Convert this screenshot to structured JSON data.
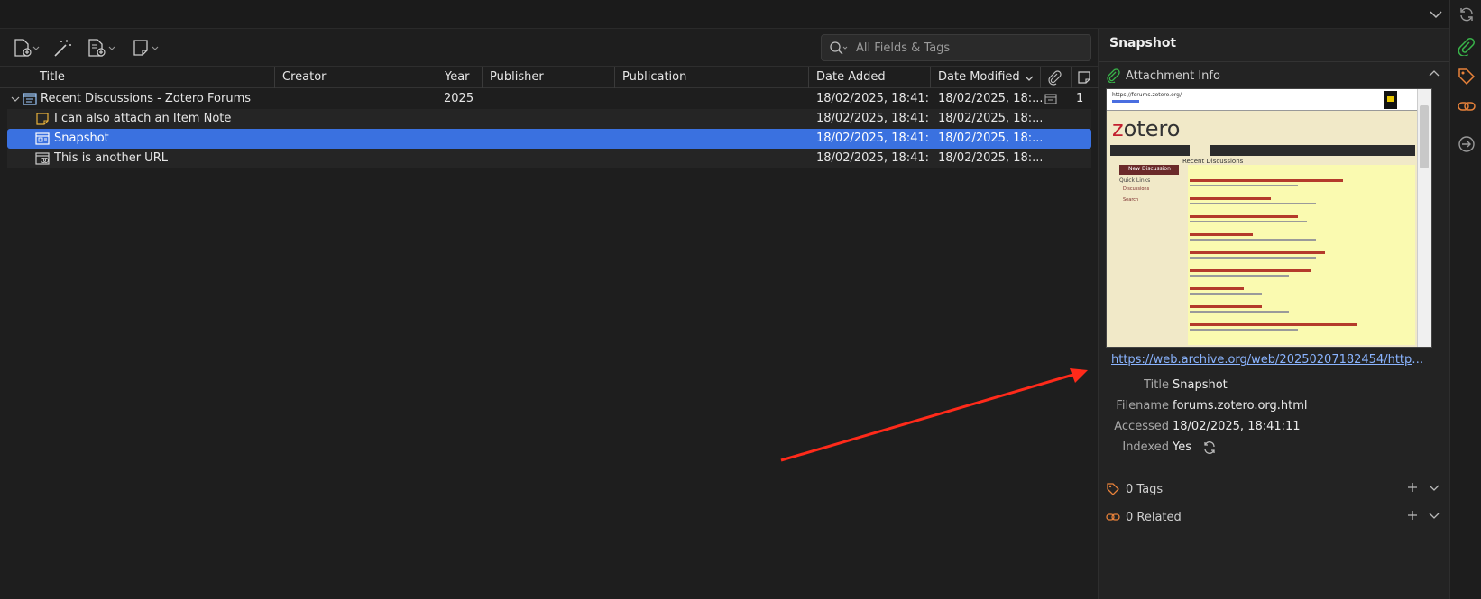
{
  "search": {
    "placeholder": "All Fields & Tags"
  },
  "columns": {
    "title": "Title",
    "creator": "Creator",
    "year": "Year",
    "publisher": "Publisher",
    "publication": "Publication",
    "date_added": "Date Added",
    "date_modified": "Date Modified"
  },
  "items": [
    {
      "title": "Recent Discussions - Zotero Forums",
      "year": "2025",
      "date_added": "18/02/2025, 18:41:...",
      "date_modified": "18/02/2025, 18:...",
      "notes": "1",
      "icon": "webpage-icon"
    },
    {
      "title": "I can also attach an Item Note",
      "year": "",
      "date_added": "18/02/2025, 18:41:...",
      "date_modified": "18/02/2025, 18:...",
      "notes": "",
      "icon": "note-icon"
    },
    {
      "title": "Snapshot",
      "year": "",
      "date_added": "18/02/2025, 18:41:...",
      "date_modified": "18/02/2025, 18:...",
      "notes": "",
      "icon": "snapshot-icon"
    },
    {
      "title": "This is another URL",
      "year": "",
      "date_added": "18/02/2025, 18:41:...",
      "date_modified": "18/02/2025, 18:...",
      "notes": "",
      "icon": "link-icon"
    }
  ],
  "pane": {
    "title": "Snapshot",
    "attachment_info": "Attachment Info",
    "url": "https://web.archive.org/web/20250207182454/https://foru...",
    "fields": [
      {
        "label": "Title",
        "value": "Snapshot"
      },
      {
        "label": "Filename",
        "value": "forums.zotero.org.html"
      },
      {
        "label": "Accessed",
        "value": "18/02/2025, 18:41:11"
      },
      {
        "label": "Indexed",
        "value": "Yes"
      }
    ],
    "tags_label": "0 Tags",
    "related_label": "0 Related"
  },
  "snapshot_preview": {
    "url_bar": "https://forums.zotero.org/",
    "logo_z": "z",
    "logo_rest": "otero",
    "heading": "Recent Discussions",
    "new_discussion": "New Discussion",
    "quick_links": "Quick Links",
    "discussions": "Discussions",
    "search": "Search"
  },
  "colors": {
    "accent": "#3a71e0",
    "link": "#8ab4ff",
    "green": "#39b54a",
    "tag_orange": "#e8823a"
  }
}
